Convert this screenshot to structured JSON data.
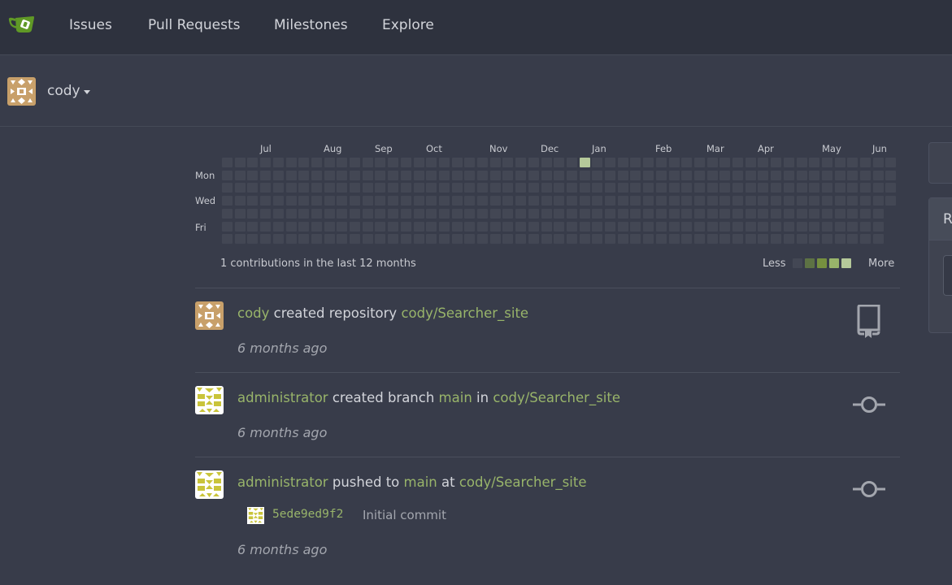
{
  "nav": {
    "items": [
      "Issues",
      "Pull Requests",
      "Milestones",
      "Explore"
    ]
  },
  "user": {
    "name": "cody"
  },
  "heatmap": {
    "months": [
      "Jul",
      "Aug",
      "Sep",
      "Oct",
      "Nov",
      "Dec",
      "Jan",
      "Feb",
      "Mar",
      "Apr",
      "May",
      "Jun"
    ],
    "days": [
      "Mon",
      "Wed",
      "Fri"
    ],
    "summary": "1 contributions in the last 12 months",
    "legend_less": "Less",
    "legend_more": "More",
    "legend_colors": [
      "#434754",
      "#5d7244",
      "#76903f",
      "#98b46a",
      "#b5c99a"
    ],
    "active_color": "#b5c99a",
    "weeks": 53,
    "active_week": 28,
    "active_day": 0,
    "total_contributions": 1
  },
  "feed": [
    {
      "actor": "cody",
      "action": "created repository",
      "repo": "cody/Searcher_site",
      "time": "6 months ago",
      "icon": "repo-icon"
    },
    {
      "actor": "administrator",
      "action": "created branch",
      "branch": "main",
      "connector": "in",
      "repo": "cody/Searcher_site",
      "time": "6 months ago",
      "icon": "commit-icon"
    },
    {
      "actor": "administrator",
      "action": "pushed to",
      "branch": "main",
      "connector": "at",
      "repo": "cody/Searcher_site",
      "commit_sha": "5ede9ed9f2",
      "commit_message": "Initial commit",
      "time": "6 months ago",
      "icon": "commit-icon"
    }
  ],
  "side_panel": {
    "header_letter": "R"
  },
  "colors": {
    "background": "#383c4a",
    "nav_background": "#2e323e",
    "link_green": "#98b46a"
  }
}
